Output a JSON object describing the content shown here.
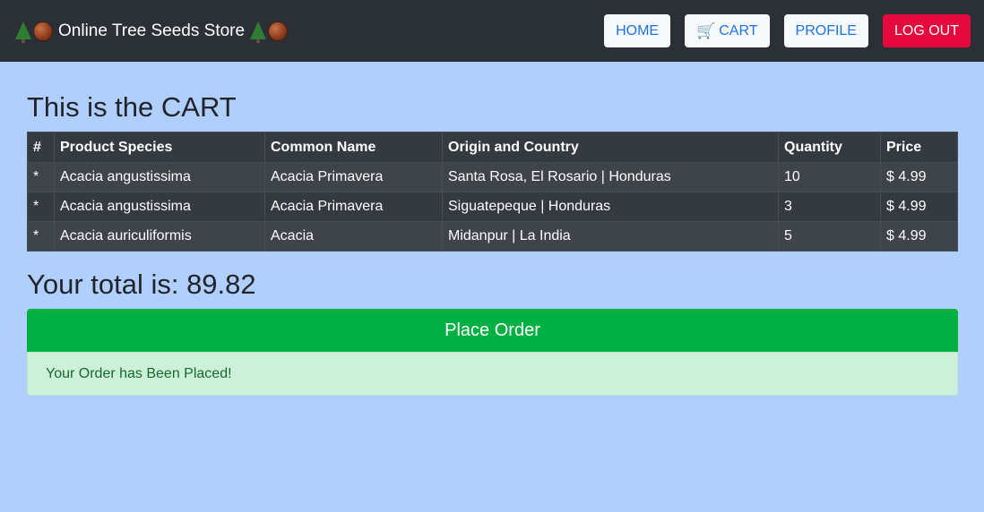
{
  "header": {
    "brand_text": "Online Tree Seeds Store",
    "nav": {
      "home": "HOME",
      "cart": "CART",
      "profile": "PROFILE",
      "logout": "LOG OUT"
    }
  },
  "main": {
    "title": "This is the CART",
    "table": {
      "headers": [
        "#",
        "Product Species",
        "Common Name",
        "Origin and Country",
        "Quantity",
        "Price"
      ],
      "rows": [
        {
          "mark": "*",
          "species": "Acacia angustissima",
          "common": "Acacia Primavera",
          "origin": "Santa Rosa, El Rosario | Honduras",
          "quantity": "10",
          "price": "$ 4.99"
        },
        {
          "mark": "*",
          "species": "Acacia angustissima",
          "common": "Acacia Primavera",
          "origin": "Siguatepeque | Honduras",
          "quantity": "3",
          "price": "$ 4.99"
        },
        {
          "mark": "*",
          "species": "Acacia auriculiformis",
          "common": "Acacia",
          "origin": "Midanpur | La India",
          "quantity": "5",
          "price": "$ 4.99"
        }
      ]
    },
    "total_text": "Your total is: 89.82",
    "place_order_label": "Place Order",
    "alert_text": "Your Order has Been Placed!"
  },
  "colors": {
    "page_bg": "#b1cffe",
    "navbar_bg": "#2b3036",
    "logout_bg": "#e5093d",
    "order_button": "#00b042",
    "alert_bg": "#cdf0d9"
  },
  "icons": [
    "tree-icon",
    "seed-icon",
    "cart-icon"
  ]
}
